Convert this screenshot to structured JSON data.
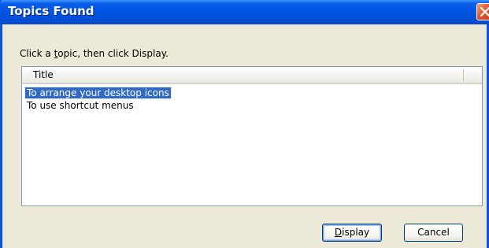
{
  "window": {
    "title": "Topics Found",
    "close_label": "Close"
  },
  "instruction": {
    "prefix": "Click a ",
    "accel_char": "t",
    "suffix": "opic, then click Display."
  },
  "list": {
    "column_title": "Title",
    "items": [
      {
        "label": "To arrange your desktop icons",
        "selected": true
      },
      {
        "label": "To use shortcut menus",
        "selected": false
      }
    ]
  },
  "buttons": {
    "display_accel": "D",
    "display_rest": "isplay",
    "cancel": "Cancel"
  },
  "colors": {
    "titlebar": "#0054e3",
    "face": "#ece9d8",
    "selection": "#316ac5",
    "close_button": "#e2562e"
  },
  "icons": {
    "close": "close-icon"
  }
}
